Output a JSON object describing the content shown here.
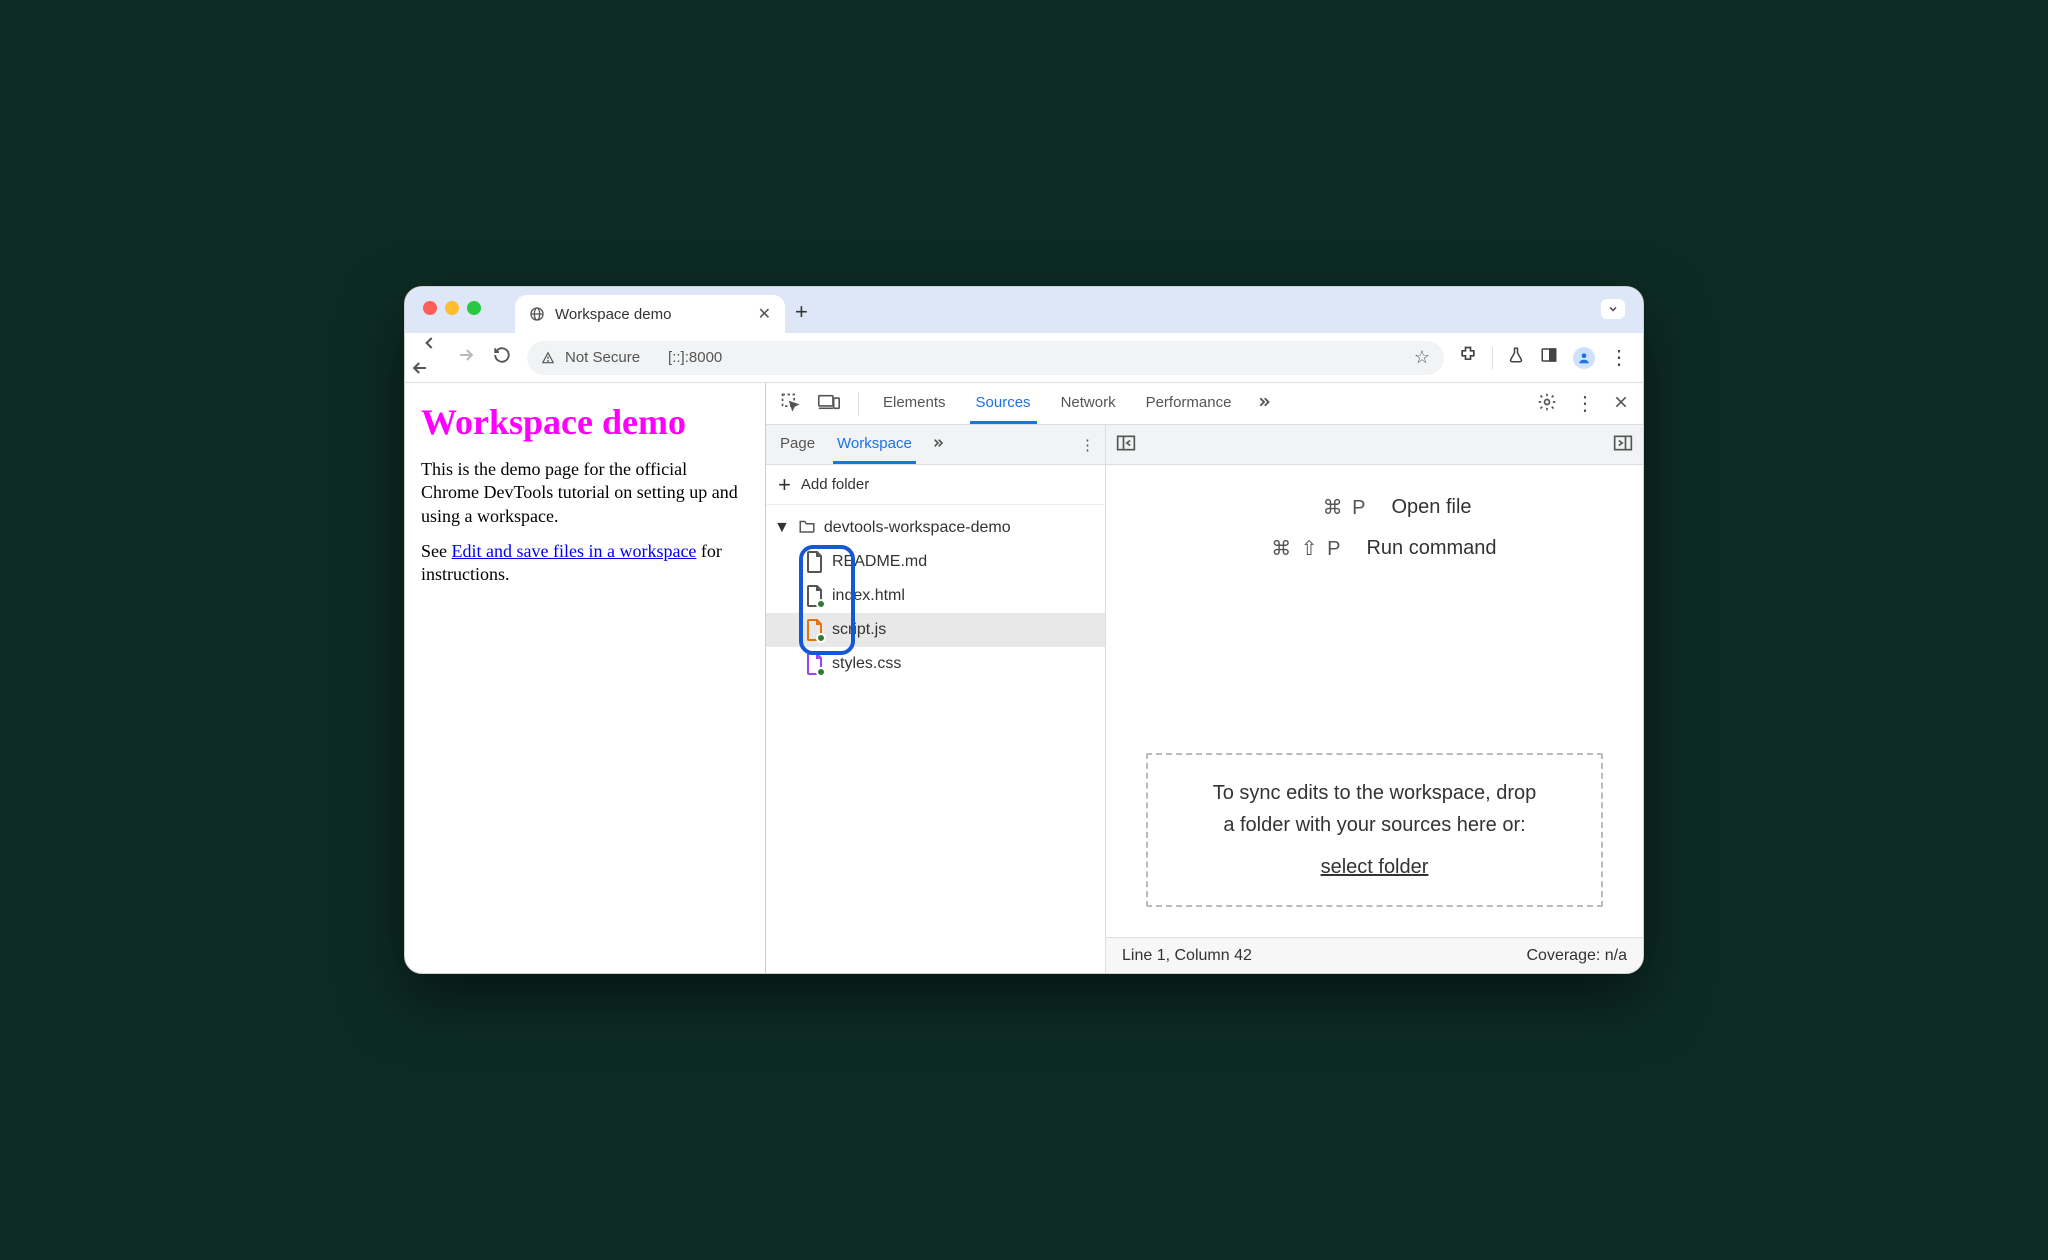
{
  "browser": {
    "tab_title": "Workspace demo",
    "address": {
      "security": "Not Secure",
      "url": "[::]:8000"
    }
  },
  "page": {
    "heading": "Workspace demo",
    "para1": "This is the demo page for the official Chrome DevTools tutorial on setting up and using a workspace.",
    "see_prefix": "See ",
    "link_text": "Edit and save files in a workspace",
    "see_suffix": " for instructions."
  },
  "devtools": {
    "tabs": {
      "elements": "Elements",
      "sources": "Sources",
      "network": "Network",
      "performance": "Performance"
    },
    "subtabs": {
      "page": "Page",
      "workspace": "Workspace"
    },
    "add_folder": "Add folder",
    "tree": {
      "root": "devtools-workspace-demo",
      "files": {
        "readme": "README.md",
        "index": "index.html",
        "script": "script.js",
        "styles": "styles.css"
      }
    },
    "hints": {
      "open_key": "⌘ P",
      "open_label": "Open file",
      "run_key": "⌘ ⇧ P",
      "run_label": "Run command"
    },
    "dropzone": {
      "line1": "To sync edits to the workspace, drop",
      "line2": "a folder with your sources here or:",
      "select": "select folder"
    },
    "status": {
      "left": "Line 1, Column 42",
      "right": "Coverage: n/a"
    }
  }
}
